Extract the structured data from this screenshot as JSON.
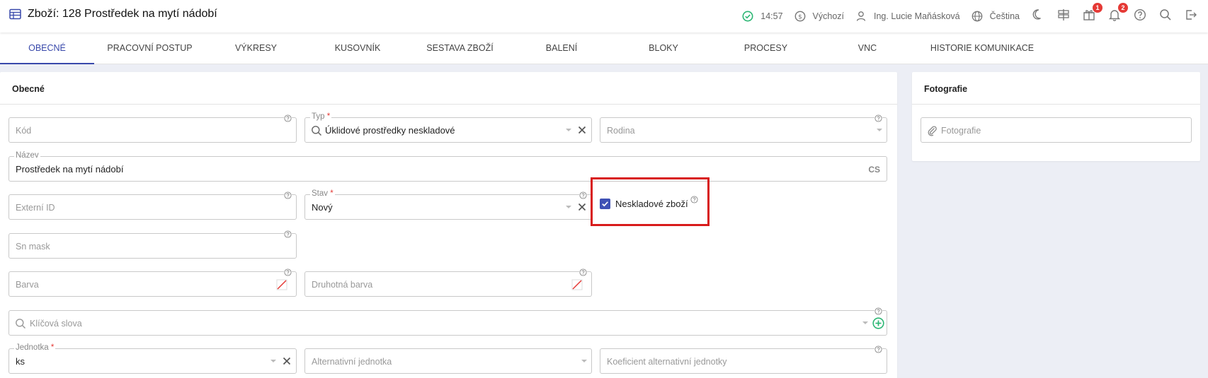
{
  "header": {
    "title": "Zboží: 128 Prostředek na mytí nádobí",
    "time": "14:57",
    "currency": "Výchozí",
    "user": "Ing. Lucie Maňásková",
    "language": "Čeština",
    "gift_badge": "1",
    "notif_badge": "2"
  },
  "tabs": [
    {
      "label": "OBECNÉ"
    },
    {
      "label": "PRACOVNÍ POSTUP"
    },
    {
      "label": "VÝKRESY"
    },
    {
      "label": "KUSOVNÍK"
    },
    {
      "label": "SESTAVA ZBOŽÍ"
    },
    {
      "label": "BALENÍ"
    },
    {
      "label": "BLOKY"
    },
    {
      "label": "PROCESY"
    },
    {
      "label": "VNC"
    },
    {
      "label": "HISTORIE KOMUNIKACE"
    }
  ],
  "general": {
    "title": "Obecné",
    "kod": {
      "placeholder": "Kód"
    },
    "typ": {
      "label": "Typ",
      "value": "Úklidové prostředky neskladové"
    },
    "rodina": {
      "placeholder": "Rodina"
    },
    "nazev": {
      "label": "Název",
      "value": "Prostředek na mytí nádobí",
      "lang": "CS"
    },
    "externi_id": {
      "placeholder": "Externí ID"
    },
    "stav": {
      "label": "Stav",
      "value": "Nový"
    },
    "neskladove": {
      "label": "Neskladové zboží",
      "checked": true
    },
    "sn_mask": {
      "placeholder": "Sn mask"
    },
    "barva": {
      "placeholder": "Barva"
    },
    "druhotna_barva": {
      "placeholder": "Druhotná barva"
    },
    "klicova_slova": {
      "placeholder": "Klíčová slova"
    },
    "jednotka": {
      "label": "Jednotka",
      "value": "ks"
    },
    "alt_jednotka": {
      "placeholder": "Alternativní jednotka"
    },
    "koeficient": {
      "placeholder": "Koeficient alternativní jednotky"
    }
  },
  "photos": {
    "title": "Fotografie",
    "placeholder": "Fotografie"
  },
  "colors": {
    "accent": "#3949ab",
    "checkbox": "#3f51b5",
    "required": "#e53935",
    "ok": "#2bb673",
    "highlight": "#d81b1b"
  }
}
